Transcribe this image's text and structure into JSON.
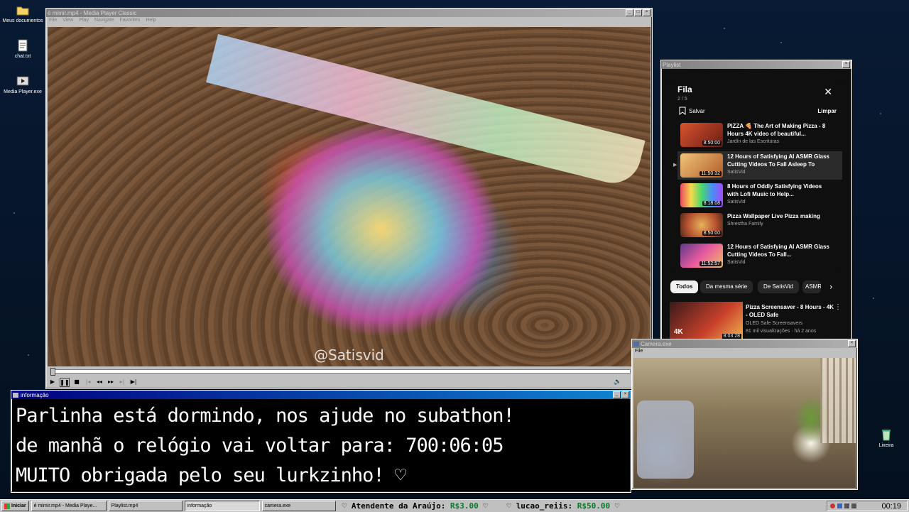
{
  "desktop": {
    "icons": [
      {
        "label": "Meus documentos"
      },
      {
        "label": "chat.txt"
      },
      {
        "label": "Media Player.exe"
      },
      {
        "label": "Lixeira"
      }
    ]
  },
  "player": {
    "title": "é mimir.mp4 - Media Player Classic",
    "menu": [
      "File",
      "View",
      "Play",
      "Navigate",
      "Favorites",
      "Help"
    ],
    "watermark": "@Satisvid"
  },
  "playlist": {
    "window_title": "Playlist",
    "header": "Fila",
    "position": "2 / 5",
    "save_label": "Salvar",
    "clear_label": "Limpar",
    "items": [
      {
        "title": "PIZZA 🍕 The Art of Making Pizza - 8 Hours 4K video of beautiful...",
        "channel": "Jardín de las Escrituras",
        "duration": "8:50:00",
        "color": "#a8392a"
      },
      {
        "title": "12 Hours of Satisfying AI ASMR Glass Cutting Videos To Fall Asleep To",
        "channel": "SatisVid",
        "duration": "11:50:32",
        "color": "#d99a4a",
        "current": true
      },
      {
        "title": "8 Hours of Oddly Satisfying Videos with Lofi Music to Help...",
        "channel": "SatisVid",
        "duration": "8:18:08",
        "color": "#9b5fd0"
      },
      {
        "title": "Pizza Wallpaper Live Pizza making",
        "channel": "Shrestha Family",
        "duration": "8:50:00",
        "color": "#b5502f"
      },
      {
        "title": "12 Hours of Satisfying AI ASMR Glass Cutting Videos To Fall...",
        "channel": "SatisVid",
        "duration": "11:52:57",
        "color": "#c85a9a"
      }
    ],
    "chips": [
      "Todos",
      "Da mesma série",
      "De SatisVid",
      "ASMR"
    ],
    "recommended": {
      "title": "Pizza Screensaver - 8 Hours - 4K - OLED Safe",
      "channel": "OLED Safe Screensavers",
      "meta": "81 mil visualizações · há 2 anos",
      "duration": "8:03:28",
      "badge": "4K"
    }
  },
  "info": {
    "title": "informação",
    "lines": [
      "Parlinha está dormindo, nos ajude no subathon!",
      "de manhã o relógio vai voltar para:  700:06:05",
      "MUITO obrigada pelo seu lurkzinho! ♡"
    ]
  },
  "camera": {
    "title": "Camera.exe",
    "menu": "File"
  },
  "taskbar": {
    "start": "Iniciar",
    "tasks": [
      "é mimir.mp4 - Media Playe...",
      "Playlist.mp4",
      "informação",
      "camera.exe"
    ],
    "ticker": [
      {
        "name": "Atendente da Araújo:",
        "amount": "R$3.00"
      },
      {
        "name": "lucao_reiis:",
        "amount": "R$50.00"
      }
    ],
    "clock": "00:19"
  }
}
